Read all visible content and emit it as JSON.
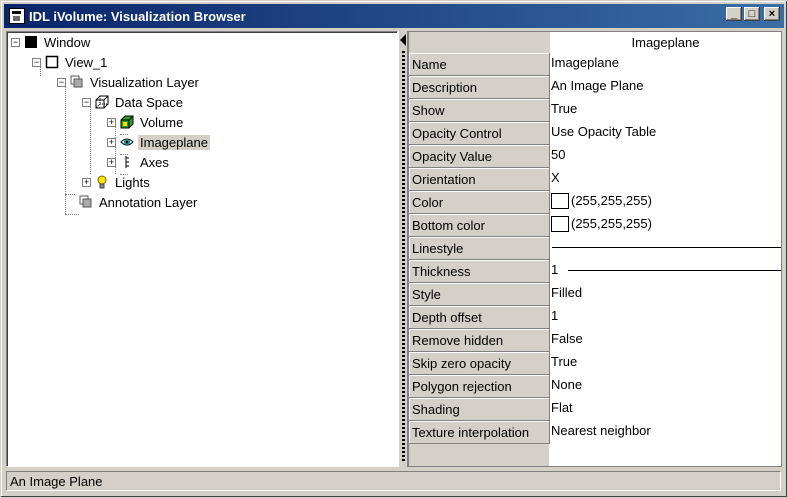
{
  "window": {
    "title": "IDL iVolume: Visualization Browser",
    "controls": {
      "minimize": "_",
      "maximize": "□",
      "close": "×"
    }
  },
  "tree": {
    "items": [
      {
        "label": "Window",
        "icon": "black-square-icon",
        "expander": "−"
      },
      {
        "label": "View_1",
        "icon": "white-square-icon",
        "expander": "−"
      },
      {
        "label": "Visualization Layer",
        "icon": "layer-icon",
        "expander": "−"
      },
      {
        "label": "Data Space",
        "icon": "cube-icon",
        "expander": "−"
      },
      {
        "label": "Volume",
        "icon": "volume-icon",
        "expander": "+"
      },
      {
        "label": "Imageplane",
        "icon": "eye-icon",
        "expander": "+",
        "selected": true
      },
      {
        "label": "Axes",
        "icon": "axes-icon",
        "expander": "+"
      },
      {
        "label": "Lights",
        "icon": "lightbulb-icon",
        "expander": "+"
      },
      {
        "label": "Annotation Layer",
        "icon": "layer-icon",
        "expander": ""
      }
    ]
  },
  "properties": {
    "column_header": "Imageplane",
    "rows": [
      {
        "name": "Name",
        "value": "Imageplane"
      },
      {
        "name": "Description",
        "value": "An Image Plane"
      },
      {
        "name": "Show",
        "value": "True"
      },
      {
        "name": "Opacity Control",
        "value": "Use Opacity Table"
      },
      {
        "name": "Opacity Value",
        "value": "50"
      },
      {
        "name": "Orientation",
        "value": "X"
      },
      {
        "name": "Color",
        "value": "(255,255,255)",
        "swatch": "#ffffff"
      },
      {
        "name": "Bottom color",
        "value": "(255,255,255)",
        "swatch": "#ffffff"
      },
      {
        "name": "Linestyle",
        "value": "",
        "line": "full"
      },
      {
        "name": "Thickness",
        "value": "1",
        "line": "partial"
      },
      {
        "name": "Style",
        "value": "Filled"
      },
      {
        "name": "Depth offset",
        "value": "1"
      },
      {
        "name": "Remove hidden",
        "value": "False"
      },
      {
        "name": "Skip zero opacity",
        "value": "True"
      },
      {
        "name": "Polygon rejection",
        "value": "None"
      },
      {
        "name": "Shading",
        "value": "Flat"
      },
      {
        "name": "Texture interpolation",
        "value": "Nearest neighbor"
      }
    ]
  },
  "status_bar": {
    "text": "An Image Plane"
  },
  "colors": {
    "title_start": "#0a246a",
    "title_end": "#3a6ea5",
    "face": "#d4d0c8"
  }
}
